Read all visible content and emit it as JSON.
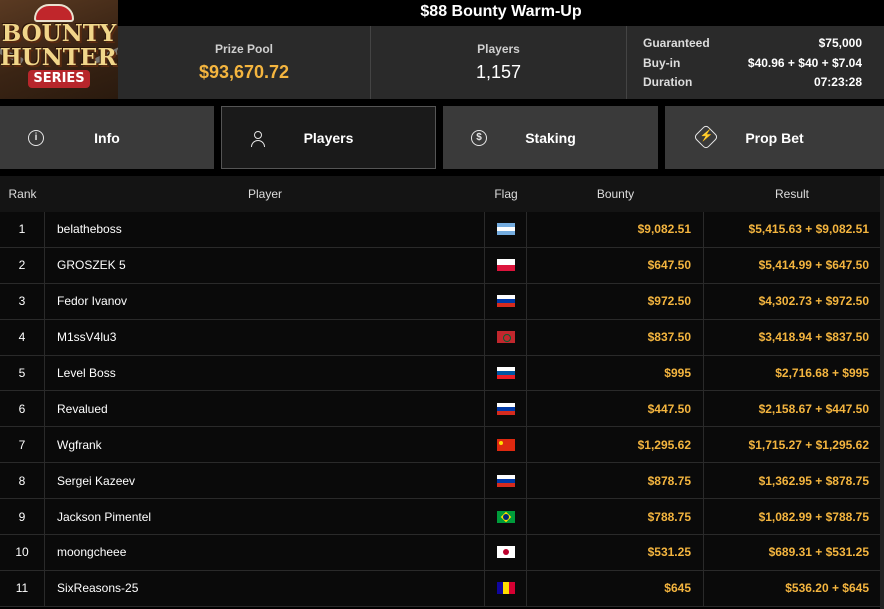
{
  "logo": {
    "line1": "BOUNTY",
    "line2": "HUNTERS",
    "line3": "SERIES"
  },
  "title": "$88 Bounty Warm-Up",
  "stats": {
    "prize_pool_label": "Prize Pool",
    "prize_pool_value": "$93,670.72",
    "players_label": "Players",
    "players_value": "1,157"
  },
  "details": [
    {
      "label": "Guaranteed",
      "value": "$75,000"
    },
    {
      "label": "Buy-in",
      "value": "$40.96 + $40 + $7.04"
    },
    {
      "label": "Duration",
      "value": "07:23:28"
    }
  ],
  "tabs": [
    {
      "label": "Info",
      "icon": "info-icon",
      "active": false
    },
    {
      "label": "Players",
      "icon": "person-icon",
      "active": true
    },
    {
      "label": "Staking",
      "icon": "dollar-coin-icon",
      "active": false
    },
    {
      "label": "Prop Bet",
      "icon": "lightning-diamond-icon",
      "active": false
    }
  ],
  "table": {
    "headers": {
      "rank": "Rank",
      "player": "Player",
      "flag": "Flag",
      "bounty": "Bounty",
      "result": "Result"
    },
    "rows": [
      {
        "rank": "1",
        "player": "belatheboss",
        "flag": "argentina-flag",
        "bounty": "$9,082.51",
        "result": "$5,415.63 + $9,082.51"
      },
      {
        "rank": "2",
        "player": "GROSZEK 5",
        "flag": "poland-flag",
        "bounty": "$647.50",
        "result": "$5,414.99 + $647.50"
      },
      {
        "rank": "3",
        "player": "Fedor Ivanov",
        "flag": "russia-flag",
        "bounty": "$972.50",
        "result": "$4,302.73 + $972.50"
      },
      {
        "rank": "4",
        "player": "M1ssV4lu3",
        "flag": "morocco-flag",
        "bounty": "$837.50",
        "result": "$3,418.94 + $837.50"
      },
      {
        "rank": "5",
        "player": "Level Boss",
        "flag": "slovenia-flag",
        "bounty": "$995",
        "result": "$2,716.68 + $995"
      },
      {
        "rank": "6",
        "player": "Revalued",
        "flag": "russia-flag",
        "bounty": "$447.50",
        "result": "$2,158.67 + $447.50"
      },
      {
        "rank": "7",
        "player": "Wgfrank",
        "flag": "china-flag",
        "bounty": "$1,295.62",
        "result": "$1,715.27 + $1,295.62"
      },
      {
        "rank": "8",
        "player": "Sergei Kazeev",
        "flag": "russia-flag",
        "bounty": "$878.75",
        "result": "$1,362.95 + $878.75"
      },
      {
        "rank": "9",
        "player": "Jackson Pimentel",
        "flag": "brazil-flag",
        "bounty": "$788.75",
        "result": "$1,082.99 + $788.75"
      },
      {
        "rank": "10",
        "player": "moongcheee",
        "flag": "japan-flag",
        "bounty": "$531.25",
        "result": "$689.31 + $531.25"
      },
      {
        "rank": "11",
        "player": "SixReasons-25",
        "flag": "andorra-flag",
        "bounty": "$645",
        "result": "$536.20 + $645"
      }
    ]
  },
  "colors": {
    "accent": "#f4b53f",
    "background": "#000000",
    "panel": "#2a2a2a",
    "tab": "#3a3a3a"
  }
}
